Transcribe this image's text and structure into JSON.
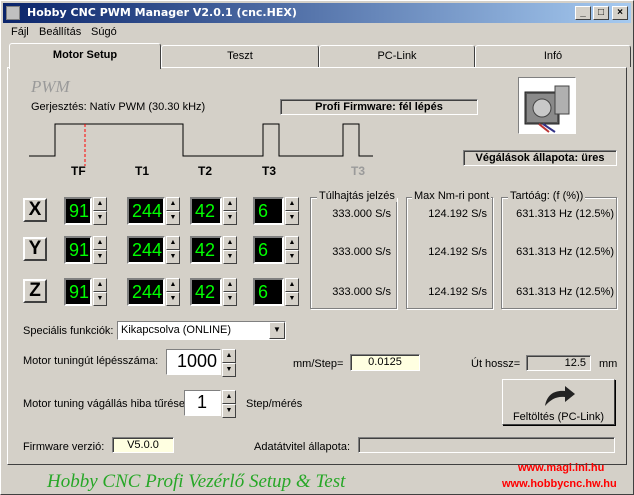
{
  "window": {
    "title": "Hobby CNC PWM Manager V2.0.1   (cnc.HEX)",
    "controls": {
      "minimize": "_",
      "maximize": "□",
      "close": "×"
    }
  },
  "menu": [
    "Fájl",
    "Beállítás",
    "Súgó"
  ],
  "tabs": [
    "Motor Setup",
    "Teszt",
    "PC-Link",
    "Infó"
  ],
  "pwm": {
    "logo": "PWM",
    "excitation": "Gerjesztés: Natív PWM (30.30 kHz)",
    "firmware_mode": "Profi Firmware: fél lépés",
    "timing_labels": [
      "TF",
      "T1",
      "T2",
      "T3",
      "T3"
    ]
  },
  "limit_status": "Végálások állapota: üres",
  "axes": [
    {
      "name": "X",
      "v1": "91",
      "v2": "244",
      "v3": "42",
      "v4": "6",
      "overspeed": "333.000 S/s",
      "max_nm": "124.192 S/s",
      "hold": "631.313 Hz (12.5%)"
    },
    {
      "name": "Y",
      "v1": "91",
      "v2": "244",
      "v3": "42",
      "v4": "6",
      "overspeed": "333.000 S/s",
      "max_nm": "124.192 S/s",
      "hold": "631.313 Hz (12.5%)"
    },
    {
      "name": "Z",
      "v1": "91",
      "v2": "244",
      "v3": "42",
      "v4": "6",
      "overspeed": "333.000 S/s",
      "max_nm": "124.192 S/s",
      "hold": "631.313 Hz (12.5%)"
    }
  ],
  "group_titles": {
    "overspeed": "Túlhajtás jelzés",
    "max_nm": "Max Nm-ri pont",
    "hold": "Tartóág: (f (%))"
  },
  "special": {
    "label": "Speciális funkciók:",
    "value": "Kikapcsolva (ONLINE)"
  },
  "tuning_steps": {
    "label": "Motor tuningút lépésszáma:",
    "value": "1000"
  },
  "mm_step": {
    "label": "mm/Step=",
    "value": "0.0125"
  },
  "travel": {
    "label": "Út hossz=",
    "value": "12.5",
    "unit": "mm"
  },
  "tuning_error": {
    "label": "Motor tuning vágállás hiba tűrése:",
    "value": "1",
    "unit": "Step/mérés"
  },
  "upload_button": "Feltöltés (PC-Link)",
  "firmware": {
    "label": "Firmware verzió:",
    "value": "V5.0.0"
  },
  "transfer": {
    "label": "Adatátvitel állapota:"
  },
  "footer": {
    "title": "Hobby CNC Profi Vezérlő Setup & Test",
    "link1": "www.magi.ini.hu",
    "link2": "www.hobbycnc.hw.hu"
  }
}
